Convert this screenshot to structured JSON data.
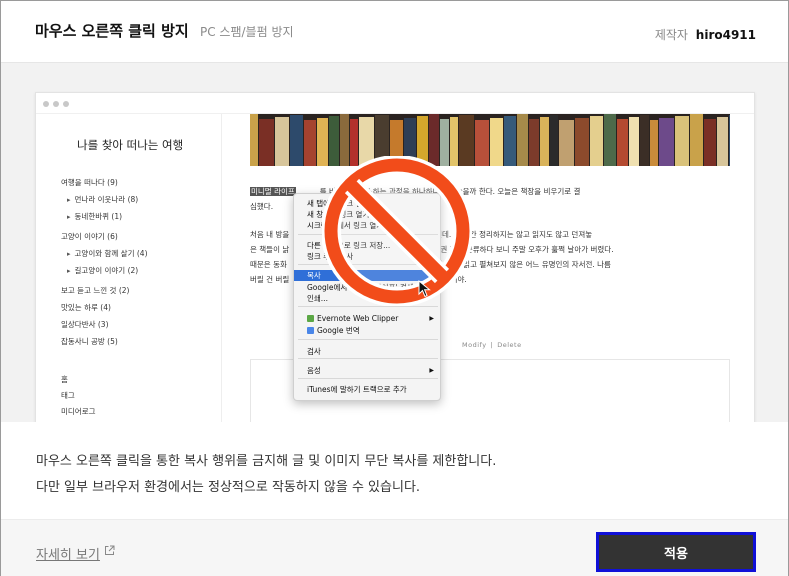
{
  "header": {
    "title": "마우스 오른쪽 클릭 방지",
    "subtitle": "PC 스팸/블펌 방지",
    "maker_label": "제작자",
    "maker_name": "hiro4911"
  },
  "preview": {
    "blog_title": "나를 찾아 떠나는 여행",
    "categories": [
      {
        "label": "여행을 떠나다 (9)",
        "sub": false
      },
      {
        "label": "먼나라 이웃나라 (8)",
        "sub": true
      },
      {
        "label": "동네한바퀴 (1)",
        "sub": true
      },
      {
        "label": "고양이 이야기 (6)",
        "sub": false
      },
      {
        "label": "고양이와 함께 살기 (4)",
        "sub": true
      },
      {
        "label": "길고양이 이야기 (2)",
        "sub": true
      },
      {
        "label": "보고 듣고 느낀 것 (2)",
        "sub": false
      },
      {
        "label": "맛있는 하루 (4)",
        "sub": false
      },
      {
        "label": "일상다반사 (3)",
        "sub": false
      },
      {
        "label": "잡동사니 공방 (5)",
        "sub": false
      },
      {
        "label": "홈",
        "sub": false
      },
      {
        "label": "태그",
        "sub": false
      },
      {
        "label": "미디어로그",
        "sub": false
      }
    ],
    "para1_highlight": "미니멀 라이프",
    "para1_rest_a": "          를 비우고자 청소하는 과정을 하나하나 남겨놓을까 한다. 오늘은 책장을 비우기로 결",
    "para1_rest_b": "심했다.",
    "para2_lines": [
      "처음 내 방을                                     서재의 이미지였을텐데. 몇 년간 정리하지는 않고 읽지도 않고 던져놓",
      "은 책들이 낡                                         로 책을 한 권 두 권 꺼내 분류하다 보니 주말 오후가 훌쩍 날아가 버렸다.",
      "때문은 동화                                       저 후감 숙제 때문에 한 번 읽고 펼쳐보지 않은 어느 유명인의 자서전. 나름",
      "버릴 건 버릴                                                          많을 줄이야."
    ],
    "post_links": [
      "Modify",
      "Delete"
    ],
    "context_menu": {
      "items": [
        "새 탭에서 링크 열기",
        "새 창에서 링크 열기",
        "시크릿 창에서 링크 열기",
        "다른 이름으로 링크 저장...",
        "링크 주소 복사",
        "복사",
        "Google에서 '미니멀 라이프' 검색",
        "인쇄...",
        "Evernote Web Clipper",
        "Google 번역",
        "검사",
        "음성",
        "iTunes에 말하기 트랙으로 추가"
      ],
      "active_index": 5
    }
  },
  "description": {
    "line1": "마우스 오른쪽 클릭을 통한 복사 행위를 금지해 글 및 이미지 무단 복사를 제한합니다.",
    "line2": "다만 일부 브라우저 환경에서는 정상적으로 작동하지 않을 수 있습니다."
  },
  "footer": {
    "more_link": "자세히 보기",
    "apply_label": "적용"
  },
  "colors": {
    "ban_orange": "#f24c1a",
    "menu_highlight": "#2f6fd8",
    "apply_bg": "#333333",
    "apply_border": "#1010d8"
  },
  "icons": {
    "external_link": "external-link-icon",
    "ban": "prohibited-icon",
    "cursor": "mouse-cursor-icon"
  }
}
